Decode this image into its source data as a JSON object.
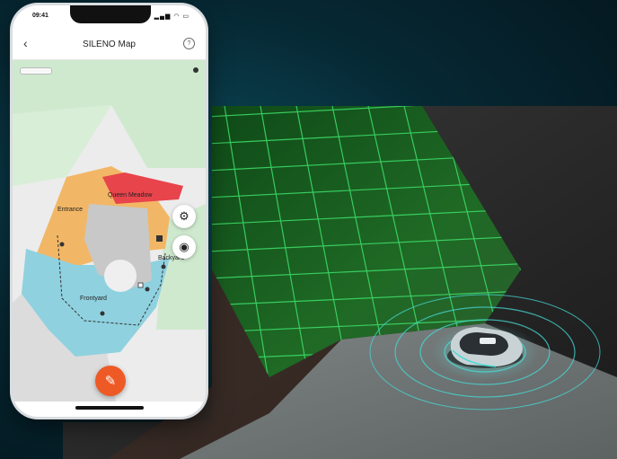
{
  "phone": {
    "status_time": "09:41",
    "status_icons": "▂▄▆ ◠ ▭",
    "app_bar": {
      "back_icon": "‹",
      "title": "SILENO Map",
      "help_icon": "?"
    },
    "map": {
      "labels": {
        "zone_red": "Queen Meadow",
        "entrance": "Entrance",
        "backyard": "Backyard",
        "frontyard": "Frontyard"
      },
      "settings_icon": "⚙",
      "view_icon": "◉",
      "edit_icon": "✎"
    }
  },
  "colors": {
    "zone_orange": "#f2b766",
    "zone_blue": "#8fd1df",
    "zone_red": "#e8444c",
    "grass_map": "#cfe9cf",
    "accent_fab": "#ee5a26",
    "grid_green": "#39d66a",
    "signal_cyan": "#46d9d4"
  }
}
